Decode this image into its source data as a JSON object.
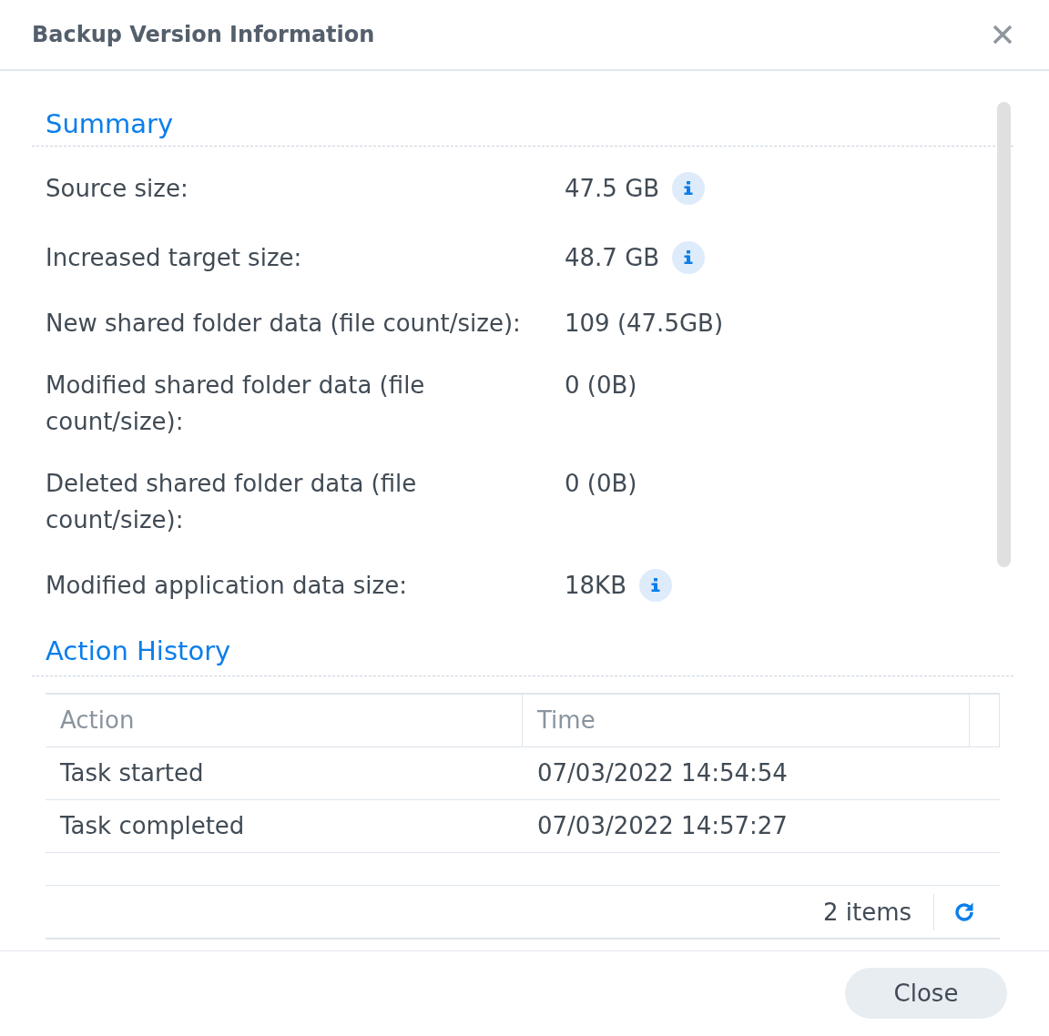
{
  "dialog": {
    "title": "Backup Version Information"
  },
  "summary": {
    "heading": "Summary",
    "rows": [
      {
        "label": "Source size:",
        "value": "47.5 GB",
        "info": true
      },
      {
        "label": "Increased target size:",
        "value": "48.7 GB",
        "info": true
      },
      {
        "label": "New shared folder data (file count/size):",
        "value": "109 (47.5GB)",
        "info": false
      },
      {
        "label": "Modified shared folder data (file count/size):",
        "value": "0 (0B)",
        "info": false
      },
      {
        "label": "Deleted shared folder data (file count/size):",
        "value": "0 (0B)",
        "info": false
      },
      {
        "label": "Modified application data size:",
        "value": "18KB",
        "info": true
      }
    ]
  },
  "action_history": {
    "heading": "Action History",
    "table": {
      "columns": [
        "Action",
        "Time"
      ],
      "rows": [
        [
          "Task started",
          "07/03/2022 14:54:54"
        ],
        [
          "Task completed",
          "07/03/2022 14:57:27"
        ]
      ]
    },
    "footer": {
      "count": "2 items"
    }
  },
  "buttons": [
    {
      "label": "Close"
    }
  ]
}
